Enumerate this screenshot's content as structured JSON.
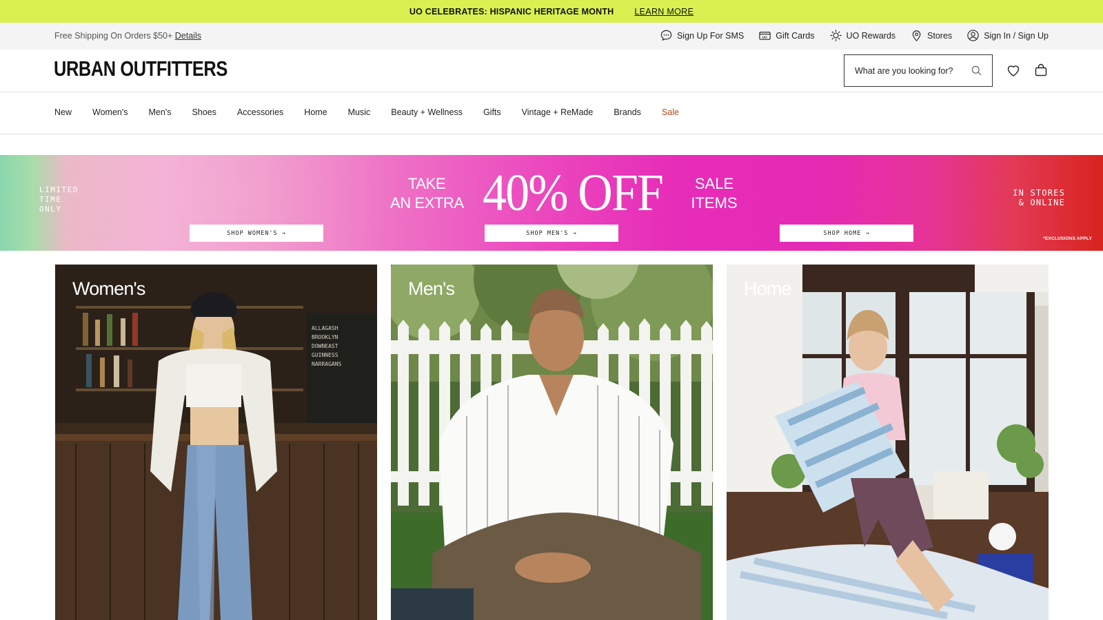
{
  "announcement": {
    "message": "UO CELEBRATES: HISPANIC HERITAGE MONTH",
    "link": "LEARN MORE"
  },
  "utility": {
    "shipping_text": "Free Shipping On Orders $50+",
    "shipping_link": "Details",
    "items": [
      {
        "label": "Sign Up For SMS",
        "icon": "chat-bubble-icon"
      },
      {
        "label": "Gift Cards",
        "icon": "gift-card-icon"
      },
      {
        "label": "UO Rewards",
        "icon": "sun-icon"
      },
      {
        "label": "Stores",
        "icon": "location-pin-icon"
      },
      {
        "label": "Sign In / Sign Up",
        "icon": "user-icon"
      }
    ]
  },
  "header": {
    "logo": "URBAN OUTFITTERS",
    "search_placeholder": "What are you looking for?"
  },
  "nav": {
    "items": [
      "New",
      "Women's",
      "Men's",
      "Shoes",
      "Accessories",
      "Home",
      "Music",
      "Beauty + Wellness",
      "Gifts",
      "Vintage + ReMade",
      "Brands",
      "Sale"
    ]
  },
  "promo": {
    "left_text": "LIMITED\nTIME\nONLY",
    "take_text": "TAKE\nAN EXTRA",
    "headline": "40% OFF",
    "sale_text": "SALE\nITEMS",
    "right_text": "IN STORES\n& ONLINE",
    "exclusions": "*EXCLUSIONS APPLY",
    "buttons": [
      "SHOP WOMEN'S →",
      "SHOP MEN'S →",
      "SHOP HOME →"
    ]
  },
  "tiles": [
    {
      "label": "Women's"
    },
    {
      "label": "Men's"
    },
    {
      "label": "Home"
    }
  ],
  "colors": {
    "announce_bg": "#d9f051",
    "sale": "#b04a1c",
    "utility_bg": "#f4f4f4"
  }
}
